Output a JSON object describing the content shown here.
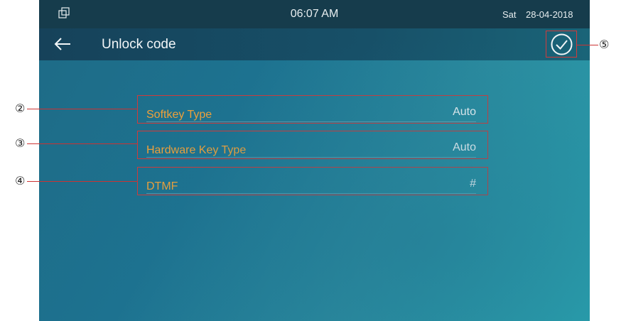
{
  "statusbar": {
    "time": "06:07 AM",
    "day": "Sat",
    "date": "28-04-2018"
  },
  "titlebar": {
    "title": "Unlock code"
  },
  "settings": [
    {
      "label": "Softkey Type",
      "value": "Auto"
    },
    {
      "label": "Hardware Key Type",
      "value": "Auto"
    },
    {
      "label": "DTMF",
      "value": "#"
    }
  ],
  "callouts": [
    "②",
    "③",
    "④",
    "⑤"
  ],
  "colors": {
    "accent_label": "#f0a13a",
    "highlight_box": "#d23a3a",
    "statusbar_bg": "#163c4c"
  },
  "icons": {
    "window": "window-icon",
    "back": "back-arrow-icon",
    "confirm": "check-circle-icon"
  }
}
